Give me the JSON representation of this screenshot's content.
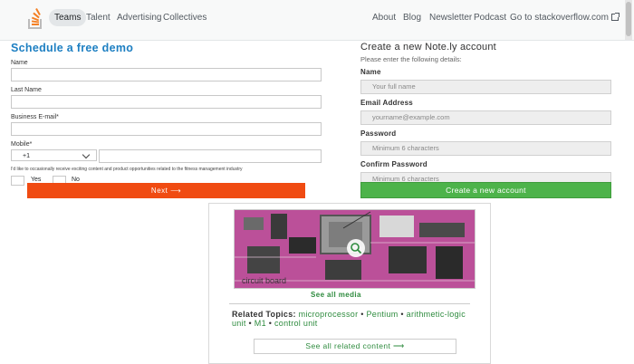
{
  "nav": {
    "logo_icon": "stackoverflow-logo-icon",
    "items": [
      {
        "label": "Teams",
        "active": true
      },
      {
        "label": "Talent"
      },
      {
        "label": "Advertising"
      },
      {
        "label": "Collectives"
      }
    ],
    "right_items": [
      {
        "label": "About"
      },
      {
        "label": "Blog"
      },
      {
        "label": "Newsletter"
      },
      {
        "label": "Podcast"
      },
      {
        "label": "Go to stackoverflow.com",
        "icon": "external-link-icon"
      }
    ]
  },
  "demo_form": {
    "title": "Schedule a free demo",
    "name_label": "Name",
    "last_name_label": "Last Name",
    "email_label": "Business E-mail*",
    "mobile_label": "Mobile*",
    "country_code": "+1",
    "consent_text": "I'd like to occasionally receive exciting content and product opportunities related to the fitness management industry",
    "yes_label": "Yes",
    "no_label": "No",
    "next_label": "Next ⟶",
    "accent_color": "#1d7fc2",
    "button_color": "#f04b12"
  },
  "account_form": {
    "title": "Create a new Note.ly account",
    "subtitle": "Please enter the following details:",
    "fields": [
      {
        "label": "Name",
        "placeholder": "Your full name"
      },
      {
        "label": "Email Address",
        "placeholder": "yourname@example.com"
      },
      {
        "label": "Password",
        "placeholder": "Minimum 6 characters"
      },
      {
        "label": "Confirm Password",
        "placeholder": "Minimum 6 characters"
      }
    ],
    "submit_label": "Create a new account",
    "button_color": "#4db34a"
  },
  "media_card": {
    "caption": "circuit board",
    "zoom_icon": "magnify-icon",
    "see_all_media": "See all media",
    "related_label": "Related Topics:",
    "topics": [
      "microprocessor",
      "Pentium",
      "arithmetic-logic unit",
      "M1",
      "control unit"
    ],
    "separator": "•",
    "see_all_related": "See all related content ⟶",
    "link_color": "#2e8b3e"
  }
}
